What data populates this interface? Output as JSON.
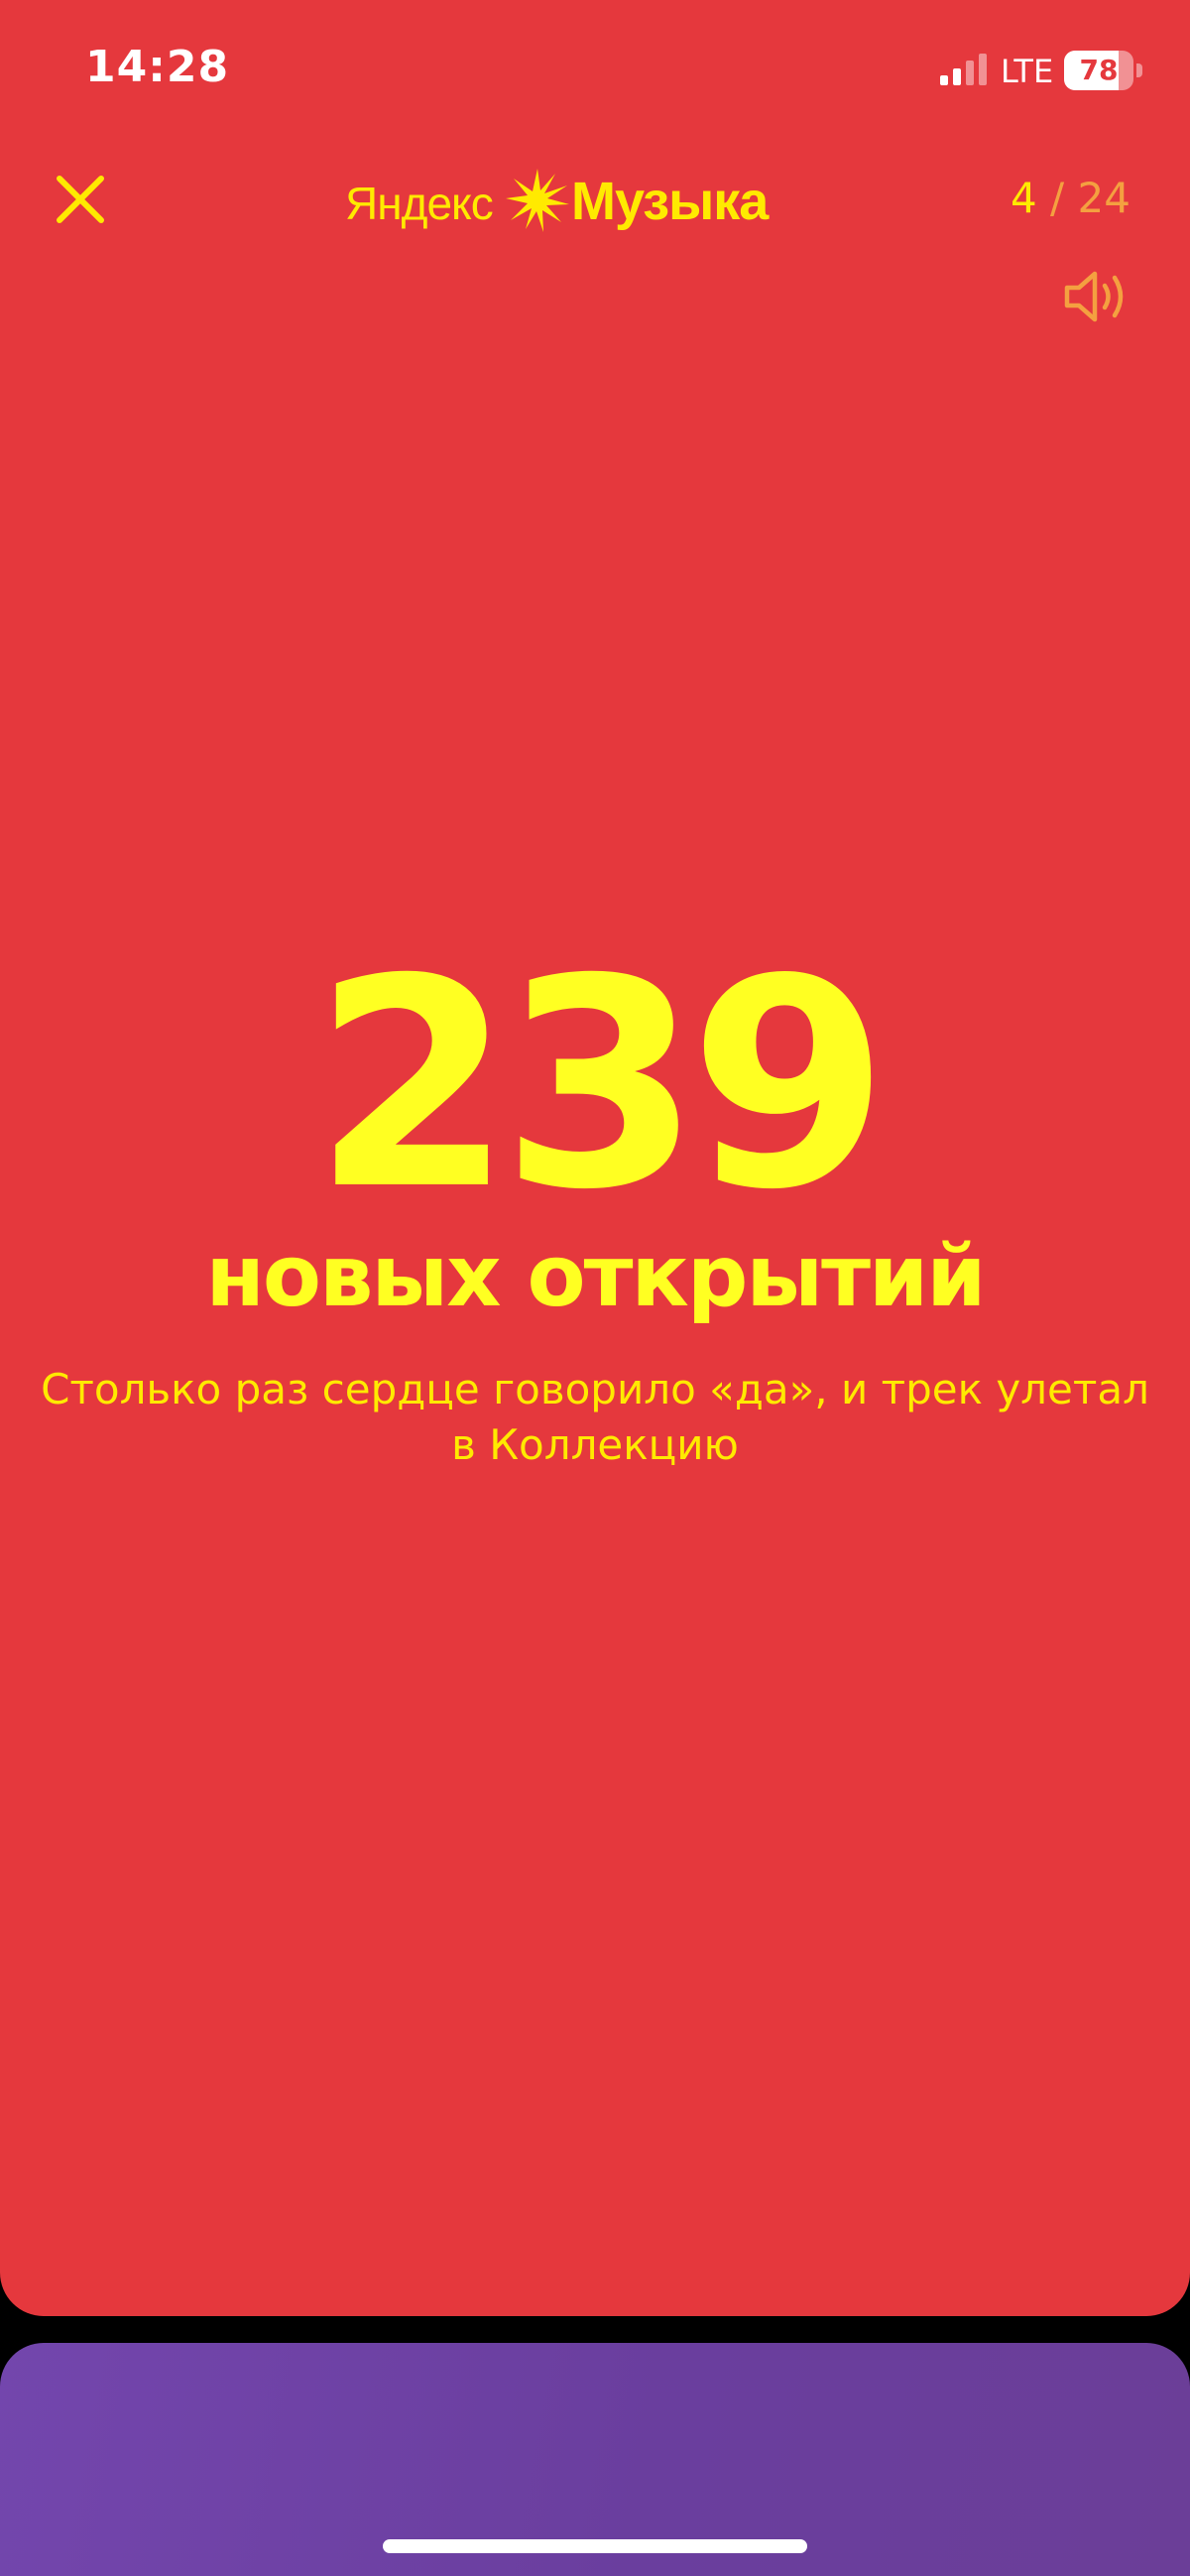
{
  "status_bar": {
    "time": "14:28",
    "network": "LTE",
    "battery_level": "78",
    "battery_fraction": 0.78
  },
  "header": {
    "logo": {
      "word_1": "Яндекс",
      "word_2": "Музыка"
    },
    "page_counter": {
      "current": "4",
      "separator": " / ",
      "total": "24"
    },
    "close_icon": "close-icon",
    "sound_icon": "speaker-icon"
  },
  "story": {
    "stat_number": "239",
    "stat_label": "новых открытий",
    "caption_line_1": "Столько раз сердце говорило «да», и трек улетал",
    "caption_line_2": "в Коллекцию"
  },
  "colors": {
    "card_background": "#e5383d",
    "accent_yellow": "#ffff22",
    "counter_orange": "#f4a040",
    "next_card_purple": "#7346ad"
  }
}
